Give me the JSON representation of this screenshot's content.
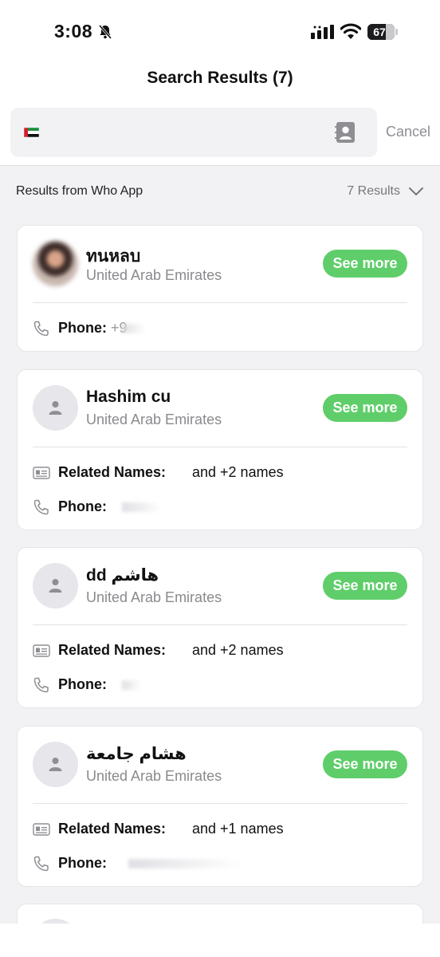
{
  "status_bar": {
    "time": "3:08",
    "battery_pct": "67",
    "battery_level": 0.67,
    "icons": [
      "bell-slash-icon",
      "cellular-signal-icon",
      "wifi-icon",
      "battery-icon"
    ]
  },
  "header": {
    "title": "Search Results (7)"
  },
  "search": {
    "flag": "uae-flag-icon",
    "value": "",
    "cancel_label": "Cancel"
  },
  "results_bar": {
    "source": "Results from Who App",
    "count": "7 Results"
  },
  "colors": {
    "see_more_green": "#5fce6a",
    "background": "#f2f2f4"
  },
  "results": [
    {
      "name": "ทนหลบ",
      "country": "United Arab Emirates",
      "see_more": "See more",
      "has_photo": true,
      "phone_label": "Phone:",
      "phone_value": "+9"
    },
    {
      "name": "Hashim cu",
      "country": "United Arab Emirates",
      "see_more": "See more",
      "related_label": "Related Names:",
      "related_value": "and +2 names",
      "phone_label": "Phone:",
      "phone_value": ""
    },
    {
      "name": "dd هاشم",
      "country": "United Arab Emirates",
      "see_more": "See more",
      "related_label": "Related Names:",
      "related_value": "and +2 names",
      "phone_label": "Phone:",
      "phone_value": ""
    },
    {
      "name": "هشام جامعة",
      "country": "United Arab Emirates",
      "see_more": "See more",
      "related_label": "Related Names:",
      "related_value": "and +1 names",
      "phone_label": "Phone:",
      "phone_value": ""
    }
  ]
}
